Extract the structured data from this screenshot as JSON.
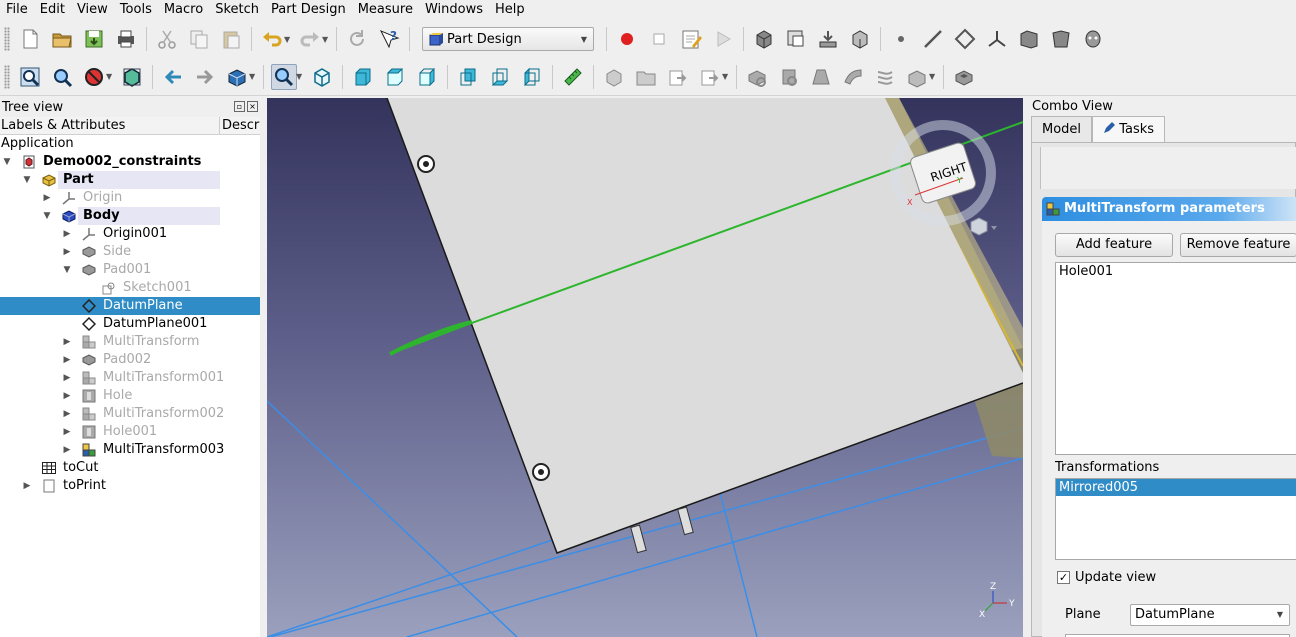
{
  "menubar": {
    "items": [
      "File",
      "Edit",
      "View",
      "Tools",
      "Macro",
      "Sketch",
      "Part Design",
      "Measure",
      "Windows",
      "Help"
    ]
  },
  "toolbar": {
    "workbench_selector": "Part Design"
  },
  "tree_view": {
    "title": "Tree view",
    "col_labels": "Labels & Attributes",
    "col_desc": "Description",
    "items": [
      {
        "label": "Application",
        "indent": 0,
        "arrow": "",
        "icon": "",
        "style": "normal"
      },
      {
        "label": "Demo002_constraints",
        "indent": 1,
        "arrow": "down",
        "icon": "document-icon",
        "style": "bold"
      },
      {
        "label": "Part",
        "indent": 2,
        "arrow": "down",
        "icon": "part-icon",
        "style": "bold-hl"
      },
      {
        "label": "Origin",
        "indent": 3,
        "arrow": "right",
        "icon": "origin-icon",
        "style": "dim"
      },
      {
        "label": "Body",
        "indent": 3,
        "arrow": "down",
        "icon": "body-icon",
        "style": "bold-hl"
      },
      {
        "label": "Origin001",
        "indent": 4,
        "arrow": "right",
        "icon": "origin-icon",
        "style": "normal"
      },
      {
        "label": "Side",
        "indent": 4,
        "arrow": "right",
        "icon": "pad-icon",
        "style": "dim"
      },
      {
        "label": "Pad001",
        "indent": 4,
        "arrow": "down",
        "icon": "pad-icon",
        "style": "dim"
      },
      {
        "label": "Sketch001",
        "indent": 5,
        "arrow": "",
        "icon": "sketch-icon",
        "style": "dim"
      },
      {
        "label": "DatumPlane",
        "indent": 4,
        "arrow": "",
        "icon": "datum-plane-icon",
        "style": "selected"
      },
      {
        "label": "DatumPlane001",
        "indent": 4,
        "arrow": "",
        "icon": "datum-plane-icon",
        "style": "normal"
      },
      {
        "label": "MultiTransform",
        "indent": 4,
        "arrow": "right",
        "icon": "multitransform-icon",
        "style": "dim"
      },
      {
        "label": "Pad002",
        "indent": 4,
        "arrow": "right",
        "icon": "pad-icon",
        "style": "dim"
      },
      {
        "label": "MultiTransform001",
        "indent": 4,
        "arrow": "right",
        "icon": "multitransform-icon",
        "style": "dim"
      },
      {
        "label": "Hole",
        "indent": 4,
        "arrow": "right",
        "icon": "hole-icon",
        "style": "dim"
      },
      {
        "label": "MultiTransform002",
        "indent": 4,
        "arrow": "right",
        "icon": "multitransform-icon",
        "style": "dim"
      },
      {
        "label": "Hole001",
        "indent": 4,
        "arrow": "right",
        "icon": "hole-icon",
        "style": "dim"
      },
      {
        "label": "MultiTransform003",
        "indent": 4,
        "arrow": "right",
        "icon": "multitransform-active-icon",
        "style": "normal"
      },
      {
        "label": "toCut",
        "indent": 2,
        "arrow": "",
        "icon": "spreadsheet-icon",
        "style": "normal"
      },
      {
        "label": "toPrint",
        "indent": 2,
        "arrow": "right",
        "icon": "page-icon",
        "style": "normal"
      }
    ]
  },
  "view3d": {
    "navcube_face": "RIGHT",
    "axis_x": "X",
    "axis_y": "Y",
    "axis_z": "Z"
  },
  "combo_view": {
    "title": "Combo View",
    "tabs": [
      "Model",
      "Tasks"
    ],
    "active_tab": "Tasks",
    "task_title": "MultiTransform parameters",
    "add_feature": "Add feature",
    "remove_feature": "Remove feature",
    "features": [
      "Hole001"
    ],
    "transformations_label": "Transformations",
    "transformations": [
      "Mirrored005"
    ],
    "update_view_label": "Update view",
    "update_view_checked": "✓",
    "plane_label": "Plane",
    "plane_value": "DatumPlane"
  },
  "colors": {
    "selection": "#308cc6",
    "task_header": "#2d8ee0",
    "sketch_line": "#2db52d",
    "datum_line": "#3a8ee8"
  }
}
